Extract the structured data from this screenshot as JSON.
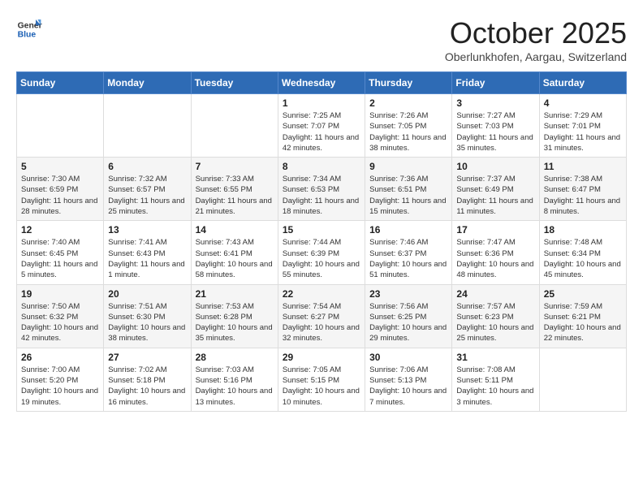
{
  "logo": {
    "general": "General",
    "blue": "Blue"
  },
  "header": {
    "month": "October 2025",
    "location": "Oberlunkhofen, Aargau, Switzerland"
  },
  "weekdays": [
    "Sunday",
    "Monday",
    "Tuesday",
    "Wednesday",
    "Thursday",
    "Friday",
    "Saturday"
  ],
  "weeks": [
    [
      {
        "day": "",
        "info": ""
      },
      {
        "day": "",
        "info": ""
      },
      {
        "day": "",
        "info": ""
      },
      {
        "day": "1",
        "info": "Sunrise: 7:25 AM\nSunset: 7:07 PM\nDaylight: 11 hours and 42 minutes."
      },
      {
        "day": "2",
        "info": "Sunrise: 7:26 AM\nSunset: 7:05 PM\nDaylight: 11 hours and 38 minutes."
      },
      {
        "day": "3",
        "info": "Sunrise: 7:27 AM\nSunset: 7:03 PM\nDaylight: 11 hours and 35 minutes."
      },
      {
        "day": "4",
        "info": "Sunrise: 7:29 AM\nSunset: 7:01 PM\nDaylight: 11 hours and 31 minutes."
      }
    ],
    [
      {
        "day": "5",
        "info": "Sunrise: 7:30 AM\nSunset: 6:59 PM\nDaylight: 11 hours and 28 minutes."
      },
      {
        "day": "6",
        "info": "Sunrise: 7:32 AM\nSunset: 6:57 PM\nDaylight: 11 hours and 25 minutes."
      },
      {
        "day": "7",
        "info": "Sunrise: 7:33 AM\nSunset: 6:55 PM\nDaylight: 11 hours and 21 minutes."
      },
      {
        "day": "8",
        "info": "Sunrise: 7:34 AM\nSunset: 6:53 PM\nDaylight: 11 hours and 18 minutes."
      },
      {
        "day": "9",
        "info": "Sunrise: 7:36 AM\nSunset: 6:51 PM\nDaylight: 11 hours and 15 minutes."
      },
      {
        "day": "10",
        "info": "Sunrise: 7:37 AM\nSunset: 6:49 PM\nDaylight: 11 hours and 11 minutes."
      },
      {
        "day": "11",
        "info": "Sunrise: 7:38 AM\nSunset: 6:47 PM\nDaylight: 11 hours and 8 minutes."
      }
    ],
    [
      {
        "day": "12",
        "info": "Sunrise: 7:40 AM\nSunset: 6:45 PM\nDaylight: 11 hours and 5 minutes."
      },
      {
        "day": "13",
        "info": "Sunrise: 7:41 AM\nSunset: 6:43 PM\nDaylight: 11 hours and 1 minute."
      },
      {
        "day": "14",
        "info": "Sunrise: 7:43 AM\nSunset: 6:41 PM\nDaylight: 10 hours and 58 minutes."
      },
      {
        "day": "15",
        "info": "Sunrise: 7:44 AM\nSunset: 6:39 PM\nDaylight: 10 hours and 55 minutes."
      },
      {
        "day": "16",
        "info": "Sunrise: 7:46 AM\nSunset: 6:37 PM\nDaylight: 10 hours and 51 minutes."
      },
      {
        "day": "17",
        "info": "Sunrise: 7:47 AM\nSunset: 6:36 PM\nDaylight: 10 hours and 48 minutes."
      },
      {
        "day": "18",
        "info": "Sunrise: 7:48 AM\nSunset: 6:34 PM\nDaylight: 10 hours and 45 minutes."
      }
    ],
    [
      {
        "day": "19",
        "info": "Sunrise: 7:50 AM\nSunset: 6:32 PM\nDaylight: 10 hours and 42 minutes."
      },
      {
        "day": "20",
        "info": "Sunrise: 7:51 AM\nSunset: 6:30 PM\nDaylight: 10 hours and 38 minutes."
      },
      {
        "day": "21",
        "info": "Sunrise: 7:53 AM\nSunset: 6:28 PM\nDaylight: 10 hours and 35 minutes."
      },
      {
        "day": "22",
        "info": "Sunrise: 7:54 AM\nSunset: 6:27 PM\nDaylight: 10 hours and 32 minutes."
      },
      {
        "day": "23",
        "info": "Sunrise: 7:56 AM\nSunset: 6:25 PM\nDaylight: 10 hours and 29 minutes."
      },
      {
        "day": "24",
        "info": "Sunrise: 7:57 AM\nSunset: 6:23 PM\nDaylight: 10 hours and 25 minutes."
      },
      {
        "day": "25",
        "info": "Sunrise: 7:59 AM\nSunset: 6:21 PM\nDaylight: 10 hours and 22 minutes."
      }
    ],
    [
      {
        "day": "26",
        "info": "Sunrise: 7:00 AM\nSunset: 5:20 PM\nDaylight: 10 hours and 19 minutes."
      },
      {
        "day": "27",
        "info": "Sunrise: 7:02 AM\nSunset: 5:18 PM\nDaylight: 10 hours and 16 minutes."
      },
      {
        "day": "28",
        "info": "Sunrise: 7:03 AM\nSunset: 5:16 PM\nDaylight: 10 hours and 13 minutes."
      },
      {
        "day": "29",
        "info": "Sunrise: 7:05 AM\nSunset: 5:15 PM\nDaylight: 10 hours and 10 minutes."
      },
      {
        "day": "30",
        "info": "Sunrise: 7:06 AM\nSunset: 5:13 PM\nDaylight: 10 hours and 7 minutes."
      },
      {
        "day": "31",
        "info": "Sunrise: 7:08 AM\nSunset: 5:11 PM\nDaylight: 10 hours and 3 minutes."
      },
      {
        "day": "",
        "info": ""
      }
    ]
  ]
}
